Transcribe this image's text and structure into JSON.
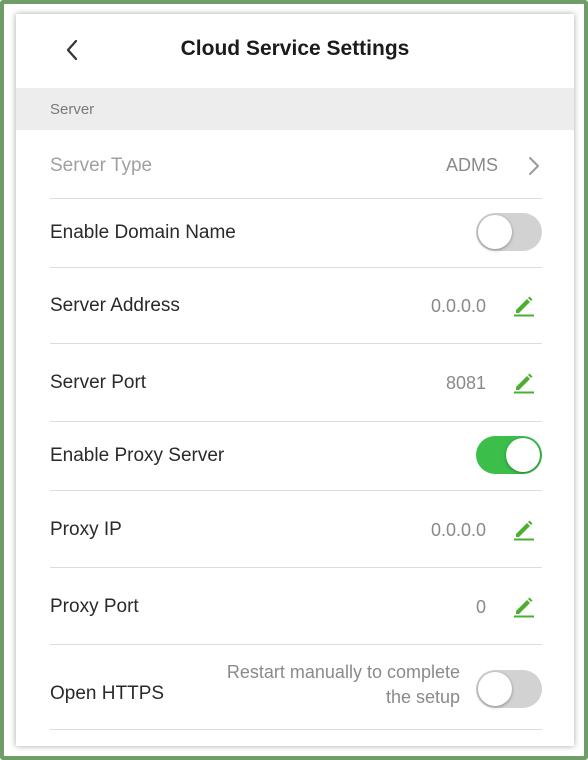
{
  "header": {
    "title": "Cloud Service Settings",
    "back_icon": "chevron-left-icon"
  },
  "section": {
    "label": "Server"
  },
  "rows": {
    "server_type": {
      "label": "Server Type",
      "value": "ADMS",
      "icon": "chevron-right-icon"
    },
    "enable_domain": {
      "label": "Enable Domain Name",
      "toggle": "off"
    },
    "server_address": {
      "label": "Server Address",
      "value": "0.0.0.0",
      "icon": "pencil-icon"
    },
    "server_port": {
      "label": "Server Port",
      "value": "8081",
      "icon": "pencil-icon"
    },
    "enable_proxy": {
      "label": "Enable Proxy Server",
      "toggle": "on"
    },
    "proxy_ip": {
      "label": "Proxy IP",
      "value": "0.0.0.0",
      "icon": "pencil-icon"
    },
    "proxy_port": {
      "label": "Proxy Port",
      "value": "0",
      "icon": "pencil-icon"
    },
    "open_https": {
      "label": "Open HTTPS",
      "note_line1": "Restart manually to complete",
      "note_line2": "the setup",
      "toggle": "off"
    }
  },
  "colors": {
    "accent": "#3bbf4a",
    "edit_icon": "#4caf2f",
    "toggle_off": "#d2d2d2",
    "section_bg": "#ededed",
    "frame": "#6f9d6a"
  }
}
